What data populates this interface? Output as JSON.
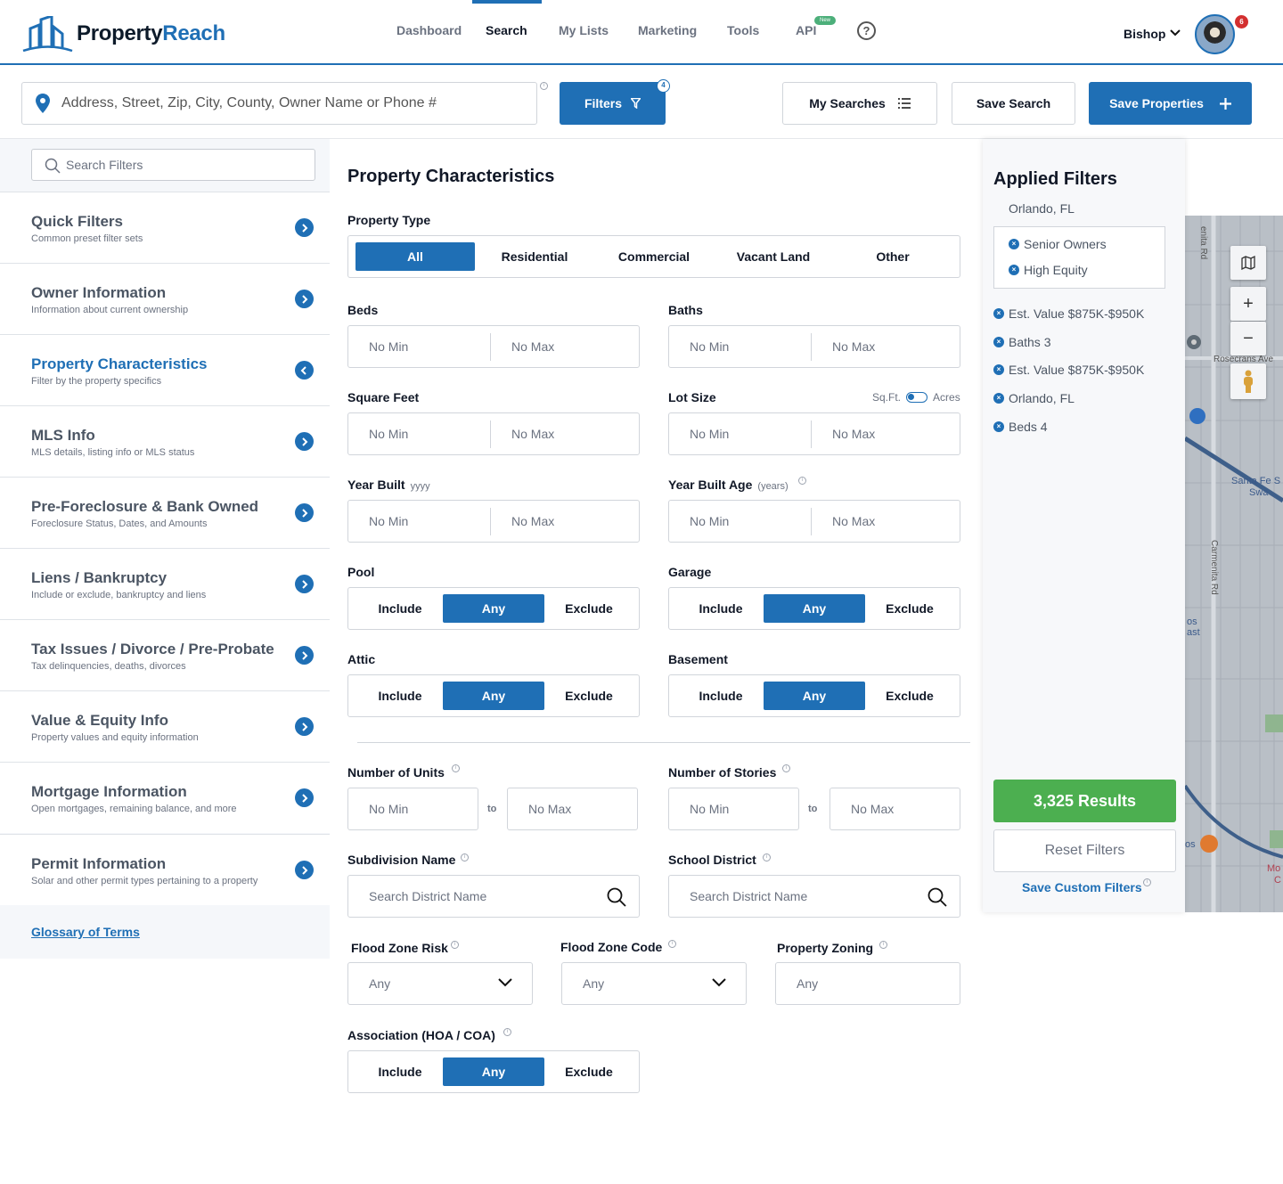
{
  "header": {
    "logo": {
      "part1": "Property",
      "part2": "Reach"
    },
    "nav": [
      "Dashboard",
      "Search",
      "My Lists",
      "Marketing",
      "Tools",
      "API"
    ],
    "new_badge": "New",
    "help": "?",
    "user": "Bishop",
    "notifications": "6"
  },
  "toolbar": {
    "address_placeholder": "Address, Street, Zip, City, County, Owner Name or Phone #",
    "filters_label": "Filters",
    "filters_count": "4",
    "my_searches": "My Searches",
    "save_search": "Save Search",
    "save_properties": "Save Properties"
  },
  "sidebar": {
    "search_placeholder": "Search Filters",
    "items": [
      {
        "title": "Quick Filters",
        "sub": "Common preset filter sets"
      },
      {
        "title": "Owner Information",
        "sub": "Information about current ownership"
      },
      {
        "title": "Property Characteristics",
        "sub": "Filter by the property specifics"
      },
      {
        "title": "MLS Info",
        "sub": "MLS details, listing info or MLS status"
      },
      {
        "title": "Pre-Foreclosure & Bank Owned",
        "sub": "Foreclosure Status, Dates, and Amounts"
      },
      {
        "title": "Liens / Bankruptcy",
        "sub": "Include or exclude, bankruptcy and liens"
      },
      {
        "title": "Tax Issues / Divorce / Pre-Probate",
        "sub": "Tax delinquencies, deaths, divorces"
      },
      {
        "title": "Value & Equity Info",
        "sub": "Property values and equity information"
      },
      {
        "title": "Mortgage Information",
        "sub": "Open mortgages, remaining balance, and more"
      },
      {
        "title": "Permit Information",
        "sub": "Solar and other permit types pertaining to a property"
      }
    ],
    "glossary": "Glossary of Terms"
  },
  "main": {
    "title": "Property Characteristics",
    "property_type": {
      "label": "Property Type",
      "options": [
        "All",
        "Residential",
        "Commercial",
        "Vacant Land",
        "Other"
      ],
      "selected": "All"
    },
    "beds": {
      "label": "Beds",
      "min": "No Min",
      "max": "No Max"
    },
    "baths": {
      "label": "Baths",
      "min": "No Min",
      "max": "No Max"
    },
    "sqft": {
      "label": "Square Feet",
      "min": "No Min",
      "max": "No Max"
    },
    "lot": {
      "label": "Lot Size",
      "unit_a": "Sq.Ft.",
      "unit_b": "Acres",
      "min": "No Min",
      "max": "No Max"
    },
    "year_built": {
      "label": "Year Built",
      "hint": "yyyy",
      "min": "No Min",
      "max": "No Max"
    },
    "year_age": {
      "label": "Year Built Age",
      "hint": "(years)",
      "min": "No Min",
      "max": "No Max"
    },
    "tri": [
      "Include",
      "Any",
      "Exclude"
    ],
    "pool": "Pool",
    "garage": "Garage",
    "attic": "Attic",
    "basement": "Basement",
    "units": {
      "label": "Number of Units",
      "min": "No Min",
      "to": "to",
      "max": "No Max"
    },
    "stories": {
      "label": "Number of Stories",
      "min": "No Min",
      "to": "to",
      "max": "No Max"
    },
    "subdivision": {
      "label": "Subdivision Name",
      "placeholder": "Search District Name"
    },
    "school": {
      "label": "School District",
      "placeholder": "Search District Name"
    },
    "flood_risk": {
      "label": "Flood Zone Risk",
      "value": "Any"
    },
    "flood_code": {
      "label": "Flood Zone Code",
      "value": "Any"
    },
    "zoning": {
      "label": "Property Zoning",
      "value": "Any"
    },
    "hoa": "Association (HOA / COA)"
  },
  "applied": {
    "title": "Applied Filters",
    "location": "Orlando, FL",
    "group": [
      "Senior Owners",
      "High Equity"
    ],
    "chips": [
      "Est. Value $875K-$950K",
      "Baths 3",
      "Est. Value $875K-$950K",
      "Orlando, FL",
      "Beds 4"
    ],
    "results": "3,325 Results",
    "reset": "Reset Filters",
    "save_custom": "Save Custom Filters"
  },
  "map": {
    "labels": [
      "enita Rd",
      "Rosecrans Ave",
      "Santa Fe S",
      "Swa",
      "Carmenita Rd",
      "os",
      "ast",
      "os",
      "Mo",
      "C"
    ],
    "zoom_in": "+",
    "zoom_out": "−"
  },
  "colors": {
    "primary": "#1f6fb5",
    "success": "#4caf50",
    "notification": "#d32f2f"
  }
}
